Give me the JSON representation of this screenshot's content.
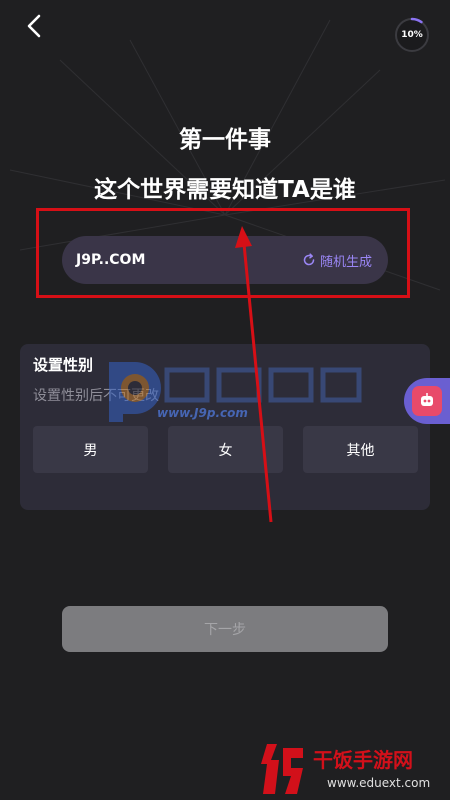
{
  "header": {
    "back_icon": "chevron-left-icon",
    "progress": {
      "value": 0.1,
      "label": "10%",
      "color": "#8b73f2"
    }
  },
  "main": {
    "title": "第一件事",
    "subtitle": "这个世界需要知道TA是谁"
  },
  "name_field": {
    "value": "J9P..COM",
    "random_label": "随机生成",
    "random_icon": "refresh-icon"
  },
  "gender": {
    "title": "设置性别",
    "hint": "设置性别后不可更改",
    "options": [
      "男",
      "女",
      "其他"
    ]
  },
  "side_button": {
    "icon": "robot-badge-icon"
  },
  "next_button": {
    "label": "下一步"
  },
  "annotation": {
    "box_color": "#d60f16",
    "arrow_color": "#d60f16"
  },
  "watermarks": {
    "center_url": "www.J9p.com",
    "site_name": "干饭手游网",
    "site_domain": "www.eduext.com"
  }
}
